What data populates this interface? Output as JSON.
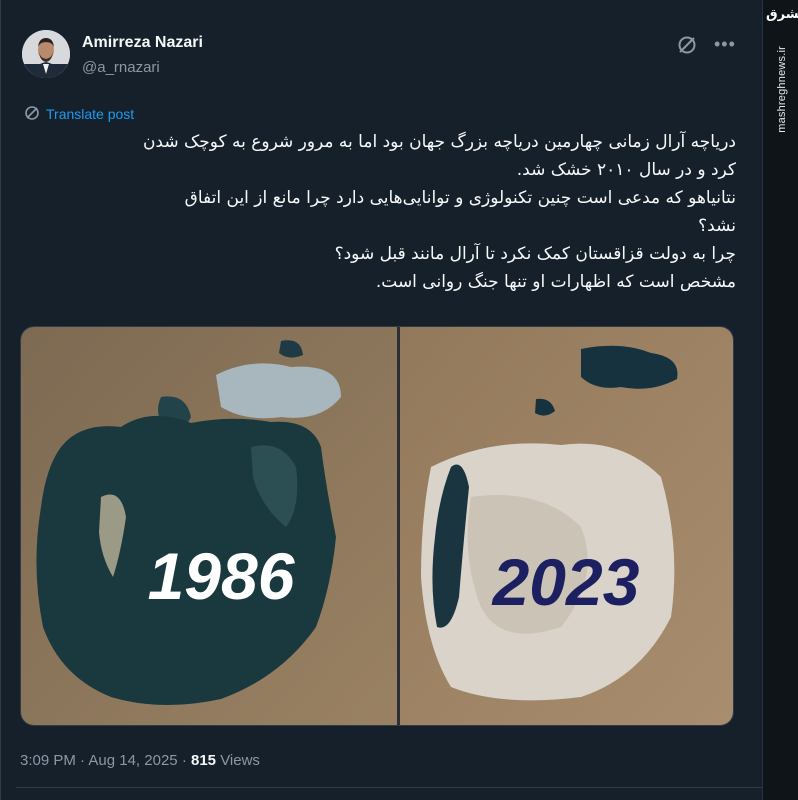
{
  "watermark": {
    "logo": "مشرق",
    "site": "mashreghnews.ir"
  },
  "author": {
    "name": "Amirreza Nazari",
    "handle": "@a_rnazari"
  },
  "actions": {
    "grok_icon": "grok-icon",
    "more_icon": "more-icon",
    "more_glyph": "•••"
  },
  "translate": {
    "label": "Translate post",
    "icon": "translate-icon"
  },
  "post": {
    "lines": [
      "دریاچه آرال زمانی چهارمین دریاچه بزرگ جهان بود اما به مرور شروع به کوچک شدن",
      "کرد و در سال ۲۰۱۰ خشک شد.",
      "نتانیاهو که مدعی است چنین تکنولوژی و توانایی‌هایی دارد چرا مانع از این اتفاق",
      "نشد؟",
      "چرا به دولت قزاقستان کمک نکرد تا آرال مانند قبل شود؟",
      "مشخص است که اظهارات او تنها جنگ روانی است."
    ]
  },
  "media": {
    "left_year": "1986",
    "right_year": "2023",
    "colors": {
      "water": "#163a3f",
      "land": "#8a7358",
      "dry": "#d8d2c8",
      "year_right": "#1c2060"
    }
  },
  "meta": {
    "time": "3:09 PM",
    "sep": "·",
    "date": "Aug 14, 2025",
    "views_count": "815",
    "views_label": "Views"
  }
}
